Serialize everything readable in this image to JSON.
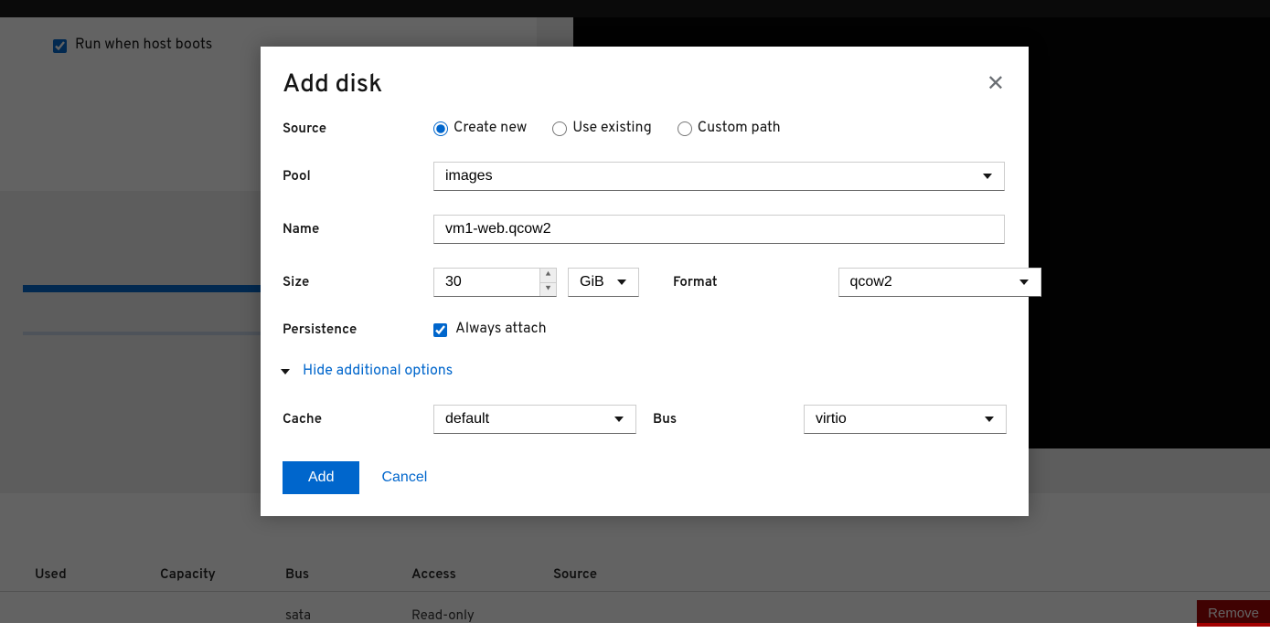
{
  "background": {
    "run_on_boot_label": "Run when host boots",
    "run_on_boot_checked": true,
    "table": {
      "headers": {
        "used": "Used",
        "capacity": "Capacity",
        "bus": "Bus",
        "access": "Access",
        "source": "Source"
      },
      "row": {
        "bus": "sata",
        "access": "Read-only"
      },
      "remove_label": "Remove"
    }
  },
  "modal": {
    "title": "Add disk",
    "labels": {
      "source": "Source",
      "pool": "Pool",
      "name": "Name",
      "size": "Size",
      "format": "Format",
      "persistence": "Persistence",
      "cache": "Cache",
      "bus": "Bus"
    },
    "source_options": {
      "create_new": "Create new",
      "use_existing": "Use existing",
      "custom_path": "Custom path"
    },
    "values": {
      "pool": "images",
      "name": "vm1-web.qcow2",
      "size": "30",
      "size_unit": "GiB",
      "format": "qcow2",
      "always_attach_label": "Always attach",
      "always_attach_checked": true,
      "cache": "default",
      "bus": "virtio"
    },
    "expander_label": "Hide additional options",
    "actions": {
      "add": "Add",
      "cancel": "Cancel"
    }
  }
}
